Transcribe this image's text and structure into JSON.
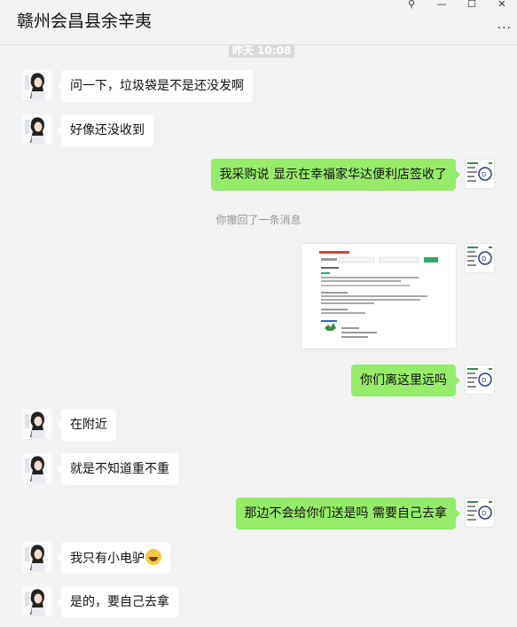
{
  "chat": {
    "title": "赣州会昌县余辛夷",
    "more": "···"
  },
  "window_controls": {
    "pin": "⚲",
    "minimize": "—",
    "maximize": "☐",
    "close": "✕"
  },
  "time_badge": "昨天 10:08",
  "recall_notice": "你撤回了一条消息",
  "messages": [
    {
      "side": "left",
      "text": "问一下，垃圾袋是不是还没发啊"
    },
    {
      "side": "left",
      "text": "好像还没收到"
    },
    {
      "side": "right",
      "text": "我采购说 显示在幸福家华达便利店签收了"
    },
    {
      "side": "right",
      "type": "image",
      "text": ""
    },
    {
      "side": "right",
      "text": "你们离这里远吗"
    },
    {
      "side": "left",
      "text": "在附近"
    },
    {
      "side": "left",
      "text": "就是不知道重不重"
    },
    {
      "side": "right",
      "text": "那边不会给你们送是吗  需要自己去拿"
    },
    {
      "side": "left",
      "text": "我只有小电驴",
      "emoji": "laughing-tears-emoji"
    },
    {
      "side": "left",
      "text": "是的，要自己去拿"
    }
  ],
  "colors": {
    "background": "#f2f2f2",
    "bubble_self": "#95ec69",
    "bubble_other": "#ffffff",
    "image_link": "#d9403a",
    "image_button": "#2aae67"
  }
}
